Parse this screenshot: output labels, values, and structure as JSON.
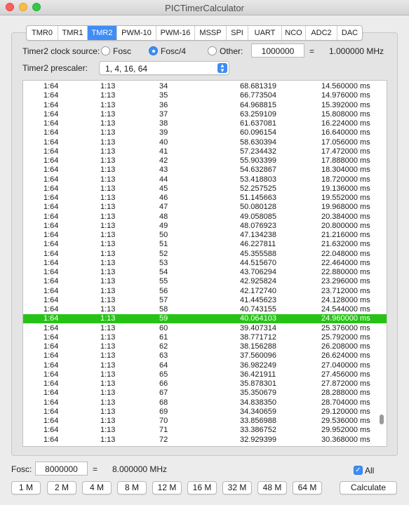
{
  "window": {
    "title": "PICTimerCalculator"
  },
  "tabs": [
    "TMR0",
    "TMR1",
    "TMR2",
    "PWM-10",
    "PWM-16",
    "MSSP",
    "SPI",
    "UART",
    "NCO",
    "ADC2",
    "DAC"
  ],
  "active_tab": "TMR2",
  "clock_source": {
    "label": "Timer2 clock source:",
    "options": [
      "Fosc",
      "Fosc/4",
      "Other:"
    ],
    "selected": "Fosc/4",
    "other_value": "1000000",
    "equals": "=",
    "result": "1.000000 MHz"
  },
  "prescaler": {
    "label": "Timer2 prescaler:",
    "value": "1, 4, 16, 64"
  },
  "table": {
    "selected_index": 25,
    "rows": [
      [
        "1:64",
        "1:13",
        "34",
        "68.681319",
        "14.560000 ms"
      ],
      [
        "1:64",
        "1:13",
        "35",
        "66.773504",
        "14.976000 ms"
      ],
      [
        "1:64",
        "1:13",
        "36",
        "64.968815",
        "15.392000 ms"
      ],
      [
        "1:64",
        "1:13",
        "37",
        "63.259109",
        "15.808000 ms"
      ],
      [
        "1:64",
        "1:13",
        "38",
        "61.637081",
        "16.224000 ms"
      ],
      [
        "1:64",
        "1:13",
        "39",
        "60.096154",
        "16.640000 ms"
      ],
      [
        "1:64",
        "1:13",
        "40",
        "58.630394",
        "17.056000 ms"
      ],
      [
        "1:64",
        "1:13",
        "41",
        "57.234432",
        "17.472000 ms"
      ],
      [
        "1:64",
        "1:13",
        "42",
        "55.903399",
        "17.888000 ms"
      ],
      [
        "1:64",
        "1:13",
        "43",
        "54.632867",
        "18.304000 ms"
      ],
      [
        "1:64",
        "1:13",
        "44",
        "53.418803",
        "18.720000 ms"
      ],
      [
        "1:64",
        "1:13",
        "45",
        "52.257525",
        "19.136000 ms"
      ],
      [
        "1:64",
        "1:13",
        "46",
        "51.145663",
        "19.552000 ms"
      ],
      [
        "1:64",
        "1:13",
        "47",
        "50.080128",
        "19.968000 ms"
      ],
      [
        "1:64",
        "1:13",
        "48",
        "49.058085",
        "20.384000 ms"
      ],
      [
        "1:64",
        "1:13",
        "49",
        "48.076923",
        "20.800000 ms"
      ],
      [
        "1:64",
        "1:13",
        "50",
        "47.134238",
        "21.216000 ms"
      ],
      [
        "1:64",
        "1:13",
        "51",
        "46.227811",
        "21.632000 ms"
      ],
      [
        "1:64",
        "1:13",
        "52",
        "45.355588",
        "22.048000 ms"
      ],
      [
        "1:64",
        "1:13",
        "53",
        "44.515670",
        "22.464000 ms"
      ],
      [
        "1:64",
        "1:13",
        "54",
        "43.706294",
        "22.880000 ms"
      ],
      [
        "1:64",
        "1:13",
        "55",
        "42.925824",
        "23.296000 ms"
      ],
      [
        "1:64",
        "1:13",
        "56",
        "42.172740",
        "23.712000 ms"
      ],
      [
        "1:64",
        "1:13",
        "57",
        "41.445623",
        "24.128000 ms"
      ],
      [
        "1:64",
        "1:13",
        "58",
        "40.743155",
        "24.544000 ms"
      ],
      [
        "1:64",
        "1:13",
        "59",
        "40.064103",
        "24.960000 ms"
      ],
      [
        "1:64",
        "1:13",
        "60",
        "39.407314",
        "25.376000 ms"
      ],
      [
        "1:64",
        "1:13",
        "61",
        "38.771712",
        "25.792000 ms"
      ],
      [
        "1:64",
        "1:13",
        "62",
        "38.156288",
        "26.208000 ms"
      ],
      [
        "1:64",
        "1:13",
        "63",
        "37.560096",
        "26.624000 ms"
      ],
      [
        "1:64",
        "1:13",
        "64",
        "36.982249",
        "27.040000 ms"
      ],
      [
        "1:64",
        "1:13",
        "65",
        "36.421911",
        "27.456000 ms"
      ],
      [
        "1:64",
        "1:13",
        "66",
        "35.878301",
        "27.872000 ms"
      ],
      [
        "1:64",
        "1:13",
        "67",
        "35.350679",
        "28.288000 ms"
      ],
      [
        "1:64",
        "1:13",
        "68",
        "34.838350",
        "28.704000 ms"
      ],
      [
        "1:64",
        "1:13",
        "69",
        "34.340659",
        "29.120000 ms"
      ],
      [
        "1:64",
        "1:13",
        "70",
        "33.856988",
        "29.536000 ms"
      ],
      [
        "1:64",
        "1:13",
        "71",
        "33.386752",
        "29.952000 ms"
      ],
      [
        "1:64",
        "1:13",
        "72",
        "32.929399",
        "30.368000 ms"
      ]
    ]
  },
  "fosc": {
    "label": "Fosc:",
    "value": "8000000",
    "equals": "=",
    "result": "8.000000 MHz"
  },
  "all_checkbox": {
    "label": "All",
    "checked": true
  },
  "freq_buttons": [
    "1 M",
    "2 M",
    "4 M",
    "8 M",
    "12 M",
    "16 M",
    "32 M",
    "48 M",
    "64 M"
  ],
  "calculate_label": "Calculate",
  "colors": {
    "accent": "#3f8df5",
    "selected_row": "#26c316"
  },
  "icons": {
    "popup_arrows": "chevron-up-down-icon",
    "checkmark": "checkmark-icon"
  }
}
